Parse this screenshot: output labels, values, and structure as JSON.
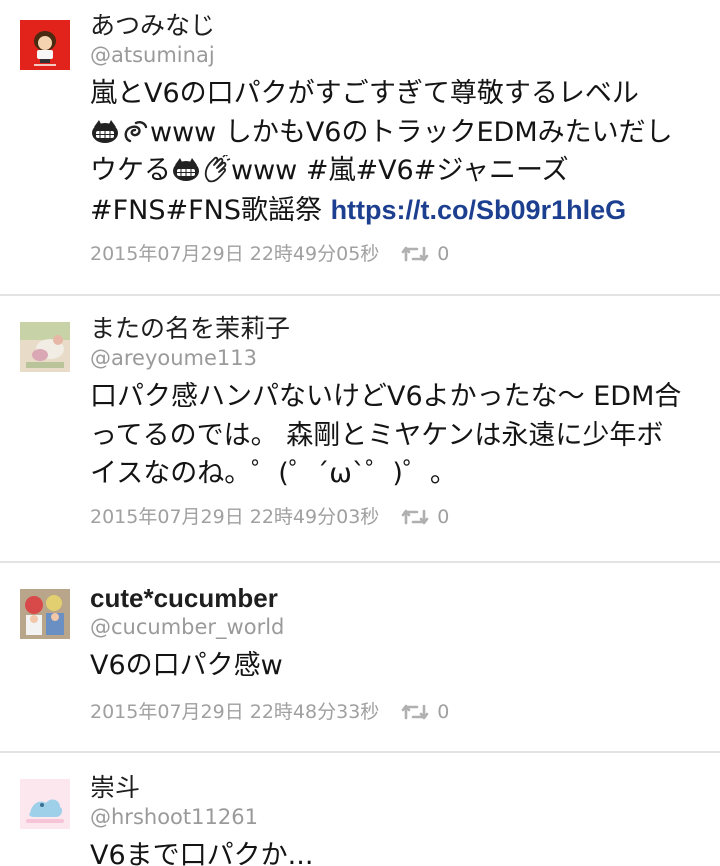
{
  "tweets": [
    {
      "name": "あつみなじ",
      "handle": "@atsuminaj",
      "text_line1": "嵐とV6の口パクがすごすぎて尊敬するレベル",
      "text_line2_a": "",
      "text_line2_b": "www しかもV6のトラックEDMみたいだし",
      "text_line3_a": "ウケる",
      "text_line3_b": "www #嵐#V6#ジャニーズ",
      "text_line4": "#FNS#FNS歌謡祭 ",
      "link": "https://t.co/Sb09r1hleG",
      "timestamp": "2015年07月29日 22時49分05秒",
      "retweets": "0"
    },
    {
      "name": "またの名を茉莉子",
      "handle": "@areyoume113",
      "text_line1": "口パク感ハンパないけどV6よかったな〜 EDM合",
      "text_line2": "ってるのでは。 森剛とミヤケンは永遠に少年ボ",
      "text_line3": "イスなのね。゜(゜´ω`゜)゜。",
      "timestamp": "2015年07月29日 22時49分03秒",
      "retweets": "0"
    },
    {
      "name": "cute*cucumber",
      "handle": "@cucumber_world",
      "text_line1": "V6の口パク感w",
      "timestamp": "2015年07月29日 22時48分33秒",
      "retweets": "0"
    },
    {
      "name": "崇斗",
      "handle": "@hrshoot11261",
      "text_line1": "V6まで口パクか..."
    }
  ],
  "colors": {
    "name": "#1e1e1e",
    "handle": "#9a9a9a",
    "meta": "#a0a0a0",
    "link": "#1d3f8f",
    "divider": "#e3e3e3"
  },
  "icons": {
    "emoji_grin": "grinning-face-icon",
    "emoji_spiral": "spiral-icon",
    "emoji_clap": "clapping-hands-icon",
    "retweet": "retweet-icon"
  }
}
